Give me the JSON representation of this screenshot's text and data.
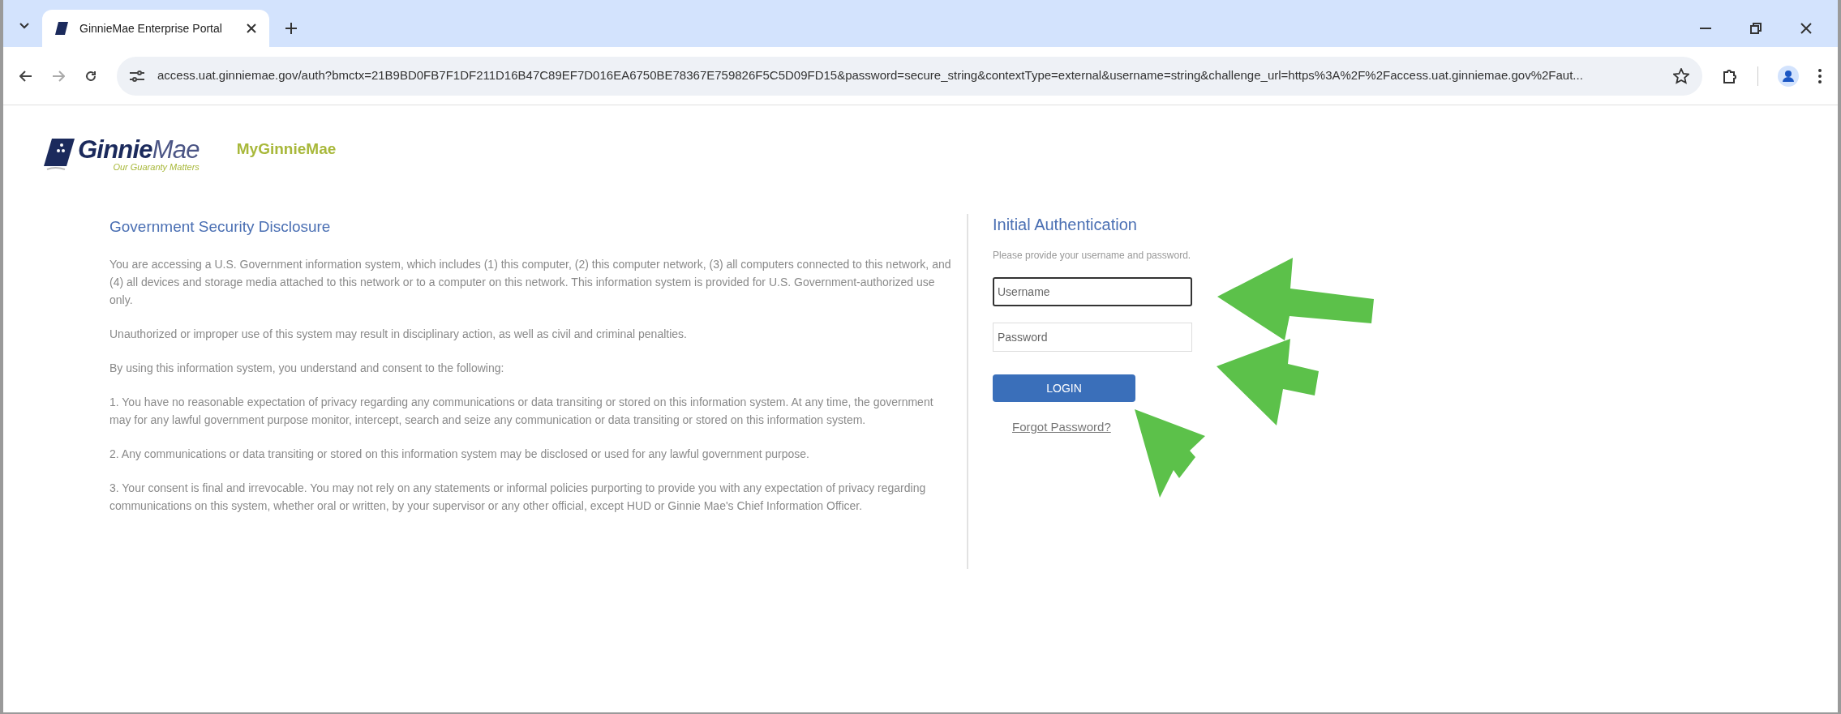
{
  "browser": {
    "tab": {
      "title": "GinnieMae Enterprise Portal",
      "selected": true
    },
    "url": "access.uat.ginniemae.gov/auth?bmctx=21B9BD0FB7F1DF211D16B47C89EF7D016EA6750BE78367E759826F5C5D09FD15&password=secure_string&contextType=external&username=string&challenge_url=https%3A%2F%2Faccess.uat.ginniemae.gov%2Faut..."
  },
  "header": {
    "logo": "**Ginnie**Mae",
    "tagline": "Our Guaranty Matters",
    "app_name": "MyGinnieMae"
  },
  "disclosure": {
    "title": "Government Security Disclosure",
    "paragraphs": [
      "You are accessing a U.S. Government information system, which includes (1) this computer, (2) this computer network, (3) all computers connected to this network, and (4) all devices and storage media attached to this network or to a computer on this network. This information system is provided for U.S. Government-authorized use only.",
      "Unauthorized or improper use of this system may result in disciplinary action, as well as civil and criminal penalties.",
      "By using this information system, you understand and consent to the following:",
      "1. You have no reasonable expectation of privacy regarding any communications or data transiting or stored on this information system. At any time, the government may for any lawful government purpose monitor, intercept, search and seize any communication or data transiting or stored on this information system.",
      "2. Any communications or data transiting or stored on this information system may be disclosed or used for any lawful government purpose.",
      "3. Your consent is final and irrevocable. You may not rely on any statements or informal policies purporting to provide you with any expectation of privacy regarding communications on this system, whether oral or written, by your supervisor or any other official, except HUD or Ginnie Mae's Chief Information Officer."
    ]
  },
  "login": {
    "title": "Initial Authentication",
    "instructions": "Please provide your username and password.",
    "fields": [
      {
        "placeholder": "Username",
        "focused": true
      },
      {
        "placeholder": "Password",
        "focused": false
      }
    ],
    "button": "LOGIN",
    "forgot_link": "Forgot Password?"
  }
}
